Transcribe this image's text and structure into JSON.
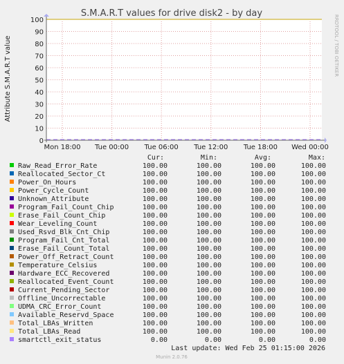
{
  "chart_data": {
    "type": "line",
    "title": "S.M.A.R.T values for drive disk2 - by day",
    "ylabel": "Attribute S.M.A.R.T value",
    "xlabel": "",
    "side_label": "RRDTOOL / TOBI OETIKER",
    "ylim": [
      0,
      100
    ],
    "yticks": [
      0,
      10,
      20,
      30,
      40,
      50,
      60,
      70,
      80,
      90,
      100
    ],
    "xtick_labels": [
      "Mon 18:00",
      "Tue 00:00",
      "Tue 06:00",
      "Tue 12:00",
      "Tue 18:00",
      "Wed 00:00"
    ],
    "grid": true,
    "legend_headers": [
      "Cur:",
      "Min:",
      "Avg:",
      "Max:"
    ],
    "series": [
      {
        "name": "Raw_Read_Error_Rate",
        "color": "#00cc00",
        "cur": "100.00",
        "min": "100.00",
        "avg": "100.00",
        "max": "100.00"
      },
      {
        "name": "Reallocated_Sector_Ct",
        "color": "#0066b3",
        "cur": "100.00",
        "min": "100.00",
        "avg": "100.00",
        "max": "100.00"
      },
      {
        "name": "Power_On_Hours",
        "color": "#ff8000",
        "cur": "100.00",
        "min": "100.00",
        "avg": "100.00",
        "max": "100.00"
      },
      {
        "name": "Power_Cycle_Count",
        "color": "#ffcc00",
        "cur": "100.00",
        "min": "100.00",
        "avg": "100.00",
        "max": "100.00"
      },
      {
        "name": "Unknown_Attribute",
        "color": "#330099",
        "cur": "100.00",
        "min": "100.00",
        "avg": "100.00",
        "max": "100.00"
      },
      {
        "name": "Program_Fail_Count_Chip",
        "color": "#990099",
        "cur": "100.00",
        "min": "100.00",
        "avg": "100.00",
        "max": "100.00"
      },
      {
        "name": "Erase_Fail_Count_Chip",
        "color": "#ccff00",
        "cur": "100.00",
        "min": "100.00",
        "avg": "100.00",
        "max": "100.00"
      },
      {
        "name": "Wear_Leveling_Count",
        "color": "#ff0000",
        "cur": "100.00",
        "min": "100.00",
        "avg": "100.00",
        "max": "100.00"
      },
      {
        "name": "Used_Rsvd_Blk_Cnt_Chip",
        "color": "#808080",
        "cur": "100.00",
        "min": "100.00",
        "avg": "100.00",
        "max": "100.00"
      },
      {
        "name": "Program_Fail_Cnt_Total",
        "color": "#008f00",
        "cur": "100.00",
        "min": "100.00",
        "avg": "100.00",
        "max": "100.00"
      },
      {
        "name": "Erase_Fail_Count_Total",
        "color": "#00487d",
        "cur": "100.00",
        "min": "100.00",
        "avg": "100.00",
        "max": "100.00"
      },
      {
        "name": "Power_Off_Retract_Count",
        "color": "#b35a00",
        "cur": "100.00",
        "min": "100.00",
        "avg": "100.00",
        "max": "100.00"
      },
      {
        "name": "Temperature_Celsius",
        "color": "#b38f00",
        "cur": "100.00",
        "min": "100.00",
        "avg": "100.00",
        "max": "100.00"
      },
      {
        "name": "Hardware_ECC_Recovered",
        "color": "#6b006b",
        "cur": "100.00",
        "min": "100.00",
        "avg": "100.00",
        "max": "100.00"
      },
      {
        "name": "Reallocated_Event_Count",
        "color": "#8fb300",
        "cur": "100.00",
        "min": "100.00",
        "avg": "100.00",
        "max": "100.00"
      },
      {
        "name": "Current_Pending_Sector",
        "color": "#b30000",
        "cur": "100.00",
        "min": "100.00",
        "avg": "100.00",
        "max": "100.00"
      },
      {
        "name": "Offline_Uncorrectable",
        "color": "#bebebe",
        "cur": "100.00",
        "min": "100.00",
        "avg": "100.00",
        "max": "100.00"
      },
      {
        "name": "UDMA_CRC_Error_Count",
        "color": "#80ff80",
        "cur": "100.00",
        "min": "100.00",
        "avg": "100.00",
        "max": "100.00"
      },
      {
        "name": "Available_Reservd_Space",
        "color": "#80c9ff",
        "cur": "100.00",
        "min": "100.00",
        "avg": "100.00",
        "max": "100.00"
      },
      {
        "name": "Total_LBAs_Written",
        "color": "#ffc080",
        "cur": "100.00",
        "min": "100.00",
        "avg": "100.00",
        "max": "100.00"
      },
      {
        "name": "Total_LBAs_Read",
        "color": "#ffe680",
        "cur": "100.00",
        "min": "100.00",
        "avg": "100.00",
        "max": "100.00"
      },
      {
        "name": "smartctl_exit_status",
        "color": "#aa80ff",
        "cur": "0.00",
        "min": "0.00",
        "avg": "0.00",
        "max": "0.00"
      }
    ],
    "last_update": "Last update: Wed Feb 25 01:15:00 2026",
    "footer": "Munin 2.0.76"
  }
}
